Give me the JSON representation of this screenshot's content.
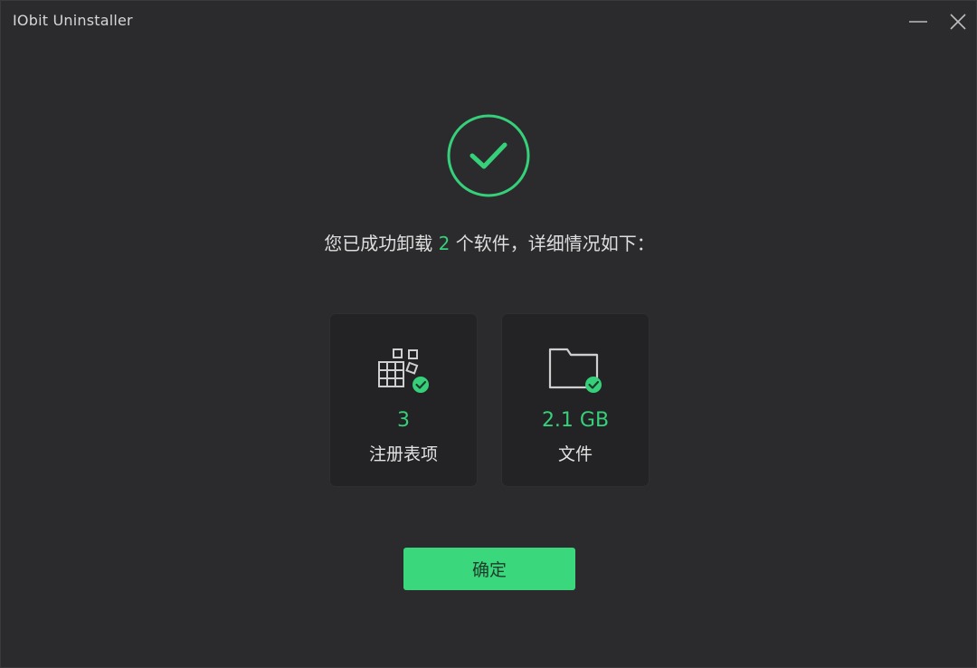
{
  "window": {
    "title": "IObit Uninstaller",
    "minimize_icon": "minimize-icon",
    "close_icon": "close-icon"
  },
  "status": {
    "icon": "check-circle-icon",
    "message_prefix": "您已成功卸载 ",
    "count": "2",
    "message_suffix": " 个软件，详细情况如下："
  },
  "cards": [
    {
      "icon": "registry-blocks-check-icon",
      "value": "3",
      "label": "注册表项"
    },
    {
      "icon": "folder-check-icon",
      "value": "2.1 GB",
      "label": "文件"
    }
  ],
  "actions": {
    "confirm_label": "确定"
  },
  "colors": {
    "accent": "#36d07a",
    "button": "#3ad77d",
    "background": "#2b2b2d",
    "card_bg": "#232325"
  }
}
